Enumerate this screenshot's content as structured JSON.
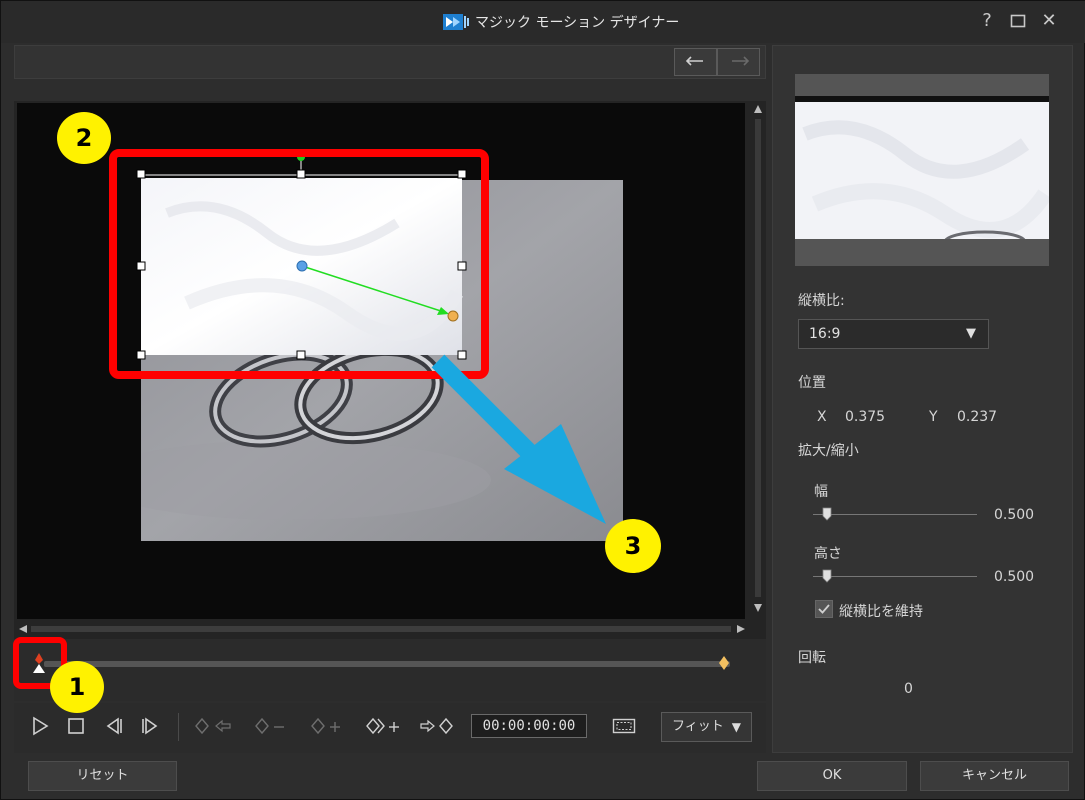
{
  "window": {
    "title": "マジック モーション デザイナー",
    "help": "?",
    "maximize": "☐",
    "close": "✕"
  },
  "controls": {
    "timecode": "00:00:00:00",
    "fit_label": "フィット"
  },
  "right_panel": {
    "aspect_label": "縦横比:",
    "aspect_value": "16:9",
    "position_label": "位置",
    "x_label": "X",
    "x_value": "0.375",
    "y_label": "Y",
    "y_value": "0.237",
    "scale_label": "拡大/縮小",
    "width_label": "幅",
    "width_value": "0.500",
    "height_label": "高さ",
    "height_value": "0.500",
    "keep_ratio_label": "縦横比を維持",
    "keep_ratio_checked": true,
    "rotation_label": "回転",
    "rotation_value": "0"
  },
  "footer": {
    "reset": "リセット",
    "ok": "OK",
    "cancel": "キャンセル"
  },
  "annotations": {
    "badge1": "1",
    "badge2": "2",
    "badge3": "3",
    "highlight_color": "#ff0000",
    "arrow_color": "#1aa8e0"
  },
  "icons": [
    "app-logo-icon",
    "undo-icon",
    "redo-icon",
    "play-icon",
    "stop-icon",
    "prev-frame-icon",
    "next-frame-icon",
    "keyframe-prev-icon",
    "keyframe-remove-icon",
    "keyframe-add-icon",
    "keyframe-duplicate-prev-icon",
    "keyframe-duplicate-next-icon",
    "safe-zone-icon"
  ]
}
